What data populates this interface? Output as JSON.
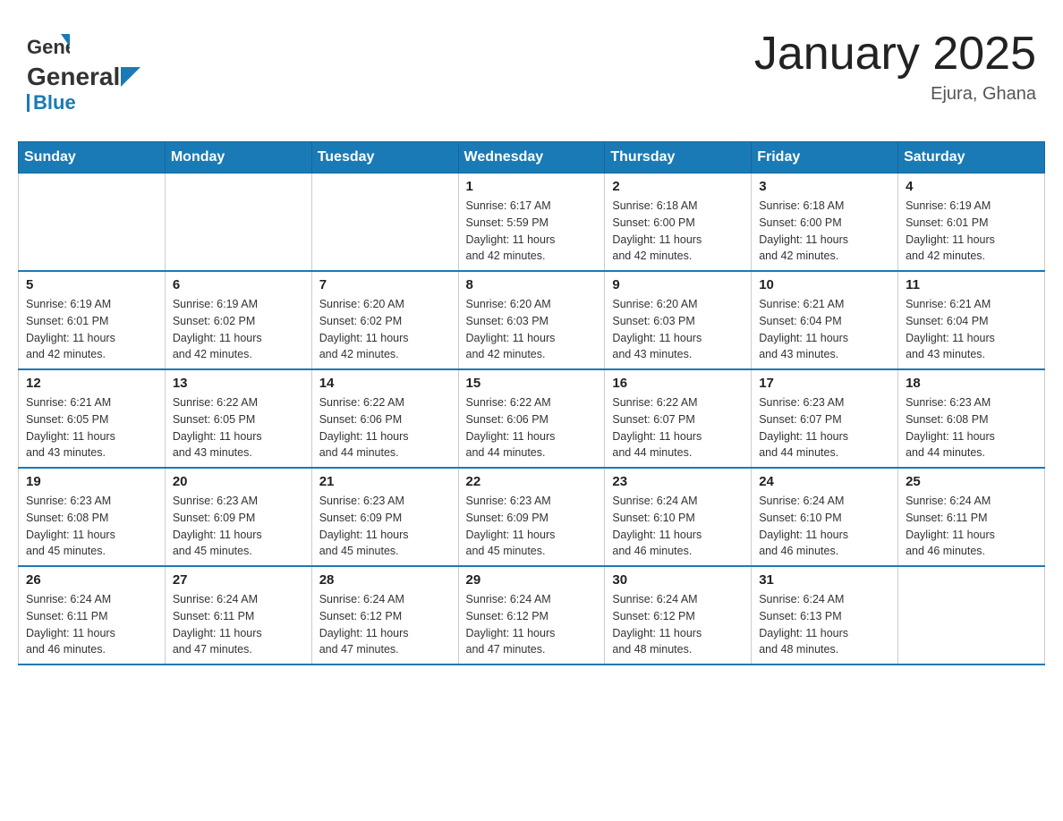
{
  "header": {
    "title": "January 2025",
    "subtitle": "Ejura, Ghana",
    "logo_general": "General",
    "logo_blue": "Blue"
  },
  "days_of_week": [
    "Sunday",
    "Monday",
    "Tuesday",
    "Wednesday",
    "Thursday",
    "Friday",
    "Saturday"
  ],
  "weeks": [
    [
      {
        "day": "",
        "info": ""
      },
      {
        "day": "",
        "info": ""
      },
      {
        "day": "",
        "info": ""
      },
      {
        "day": "1",
        "info": "Sunrise: 6:17 AM\nSunset: 5:59 PM\nDaylight: 11 hours\nand 42 minutes."
      },
      {
        "day": "2",
        "info": "Sunrise: 6:18 AM\nSunset: 6:00 PM\nDaylight: 11 hours\nand 42 minutes."
      },
      {
        "day": "3",
        "info": "Sunrise: 6:18 AM\nSunset: 6:00 PM\nDaylight: 11 hours\nand 42 minutes."
      },
      {
        "day": "4",
        "info": "Sunrise: 6:19 AM\nSunset: 6:01 PM\nDaylight: 11 hours\nand 42 minutes."
      }
    ],
    [
      {
        "day": "5",
        "info": "Sunrise: 6:19 AM\nSunset: 6:01 PM\nDaylight: 11 hours\nand 42 minutes."
      },
      {
        "day": "6",
        "info": "Sunrise: 6:19 AM\nSunset: 6:02 PM\nDaylight: 11 hours\nand 42 minutes."
      },
      {
        "day": "7",
        "info": "Sunrise: 6:20 AM\nSunset: 6:02 PM\nDaylight: 11 hours\nand 42 minutes."
      },
      {
        "day": "8",
        "info": "Sunrise: 6:20 AM\nSunset: 6:03 PM\nDaylight: 11 hours\nand 42 minutes."
      },
      {
        "day": "9",
        "info": "Sunrise: 6:20 AM\nSunset: 6:03 PM\nDaylight: 11 hours\nand 43 minutes."
      },
      {
        "day": "10",
        "info": "Sunrise: 6:21 AM\nSunset: 6:04 PM\nDaylight: 11 hours\nand 43 minutes."
      },
      {
        "day": "11",
        "info": "Sunrise: 6:21 AM\nSunset: 6:04 PM\nDaylight: 11 hours\nand 43 minutes."
      }
    ],
    [
      {
        "day": "12",
        "info": "Sunrise: 6:21 AM\nSunset: 6:05 PM\nDaylight: 11 hours\nand 43 minutes."
      },
      {
        "day": "13",
        "info": "Sunrise: 6:22 AM\nSunset: 6:05 PM\nDaylight: 11 hours\nand 43 minutes."
      },
      {
        "day": "14",
        "info": "Sunrise: 6:22 AM\nSunset: 6:06 PM\nDaylight: 11 hours\nand 44 minutes."
      },
      {
        "day": "15",
        "info": "Sunrise: 6:22 AM\nSunset: 6:06 PM\nDaylight: 11 hours\nand 44 minutes."
      },
      {
        "day": "16",
        "info": "Sunrise: 6:22 AM\nSunset: 6:07 PM\nDaylight: 11 hours\nand 44 minutes."
      },
      {
        "day": "17",
        "info": "Sunrise: 6:23 AM\nSunset: 6:07 PM\nDaylight: 11 hours\nand 44 minutes."
      },
      {
        "day": "18",
        "info": "Sunrise: 6:23 AM\nSunset: 6:08 PM\nDaylight: 11 hours\nand 44 minutes."
      }
    ],
    [
      {
        "day": "19",
        "info": "Sunrise: 6:23 AM\nSunset: 6:08 PM\nDaylight: 11 hours\nand 45 minutes."
      },
      {
        "day": "20",
        "info": "Sunrise: 6:23 AM\nSunset: 6:09 PM\nDaylight: 11 hours\nand 45 minutes."
      },
      {
        "day": "21",
        "info": "Sunrise: 6:23 AM\nSunset: 6:09 PM\nDaylight: 11 hours\nand 45 minutes."
      },
      {
        "day": "22",
        "info": "Sunrise: 6:23 AM\nSunset: 6:09 PM\nDaylight: 11 hours\nand 45 minutes."
      },
      {
        "day": "23",
        "info": "Sunrise: 6:24 AM\nSunset: 6:10 PM\nDaylight: 11 hours\nand 46 minutes."
      },
      {
        "day": "24",
        "info": "Sunrise: 6:24 AM\nSunset: 6:10 PM\nDaylight: 11 hours\nand 46 minutes."
      },
      {
        "day": "25",
        "info": "Sunrise: 6:24 AM\nSunset: 6:11 PM\nDaylight: 11 hours\nand 46 minutes."
      }
    ],
    [
      {
        "day": "26",
        "info": "Sunrise: 6:24 AM\nSunset: 6:11 PM\nDaylight: 11 hours\nand 46 minutes."
      },
      {
        "day": "27",
        "info": "Sunrise: 6:24 AM\nSunset: 6:11 PM\nDaylight: 11 hours\nand 47 minutes."
      },
      {
        "day": "28",
        "info": "Sunrise: 6:24 AM\nSunset: 6:12 PM\nDaylight: 11 hours\nand 47 minutes."
      },
      {
        "day": "29",
        "info": "Sunrise: 6:24 AM\nSunset: 6:12 PM\nDaylight: 11 hours\nand 47 minutes."
      },
      {
        "day": "30",
        "info": "Sunrise: 6:24 AM\nSunset: 6:12 PM\nDaylight: 11 hours\nand 48 minutes."
      },
      {
        "day": "31",
        "info": "Sunrise: 6:24 AM\nSunset: 6:13 PM\nDaylight: 11 hours\nand 48 minutes."
      },
      {
        "day": "",
        "info": ""
      }
    ]
  ]
}
